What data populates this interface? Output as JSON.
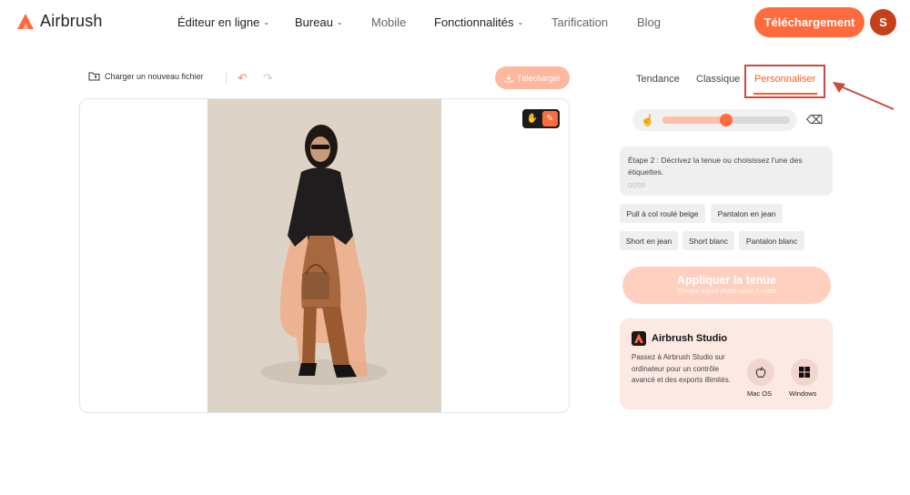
{
  "header": {
    "logo_text": "Airbrush",
    "nav": [
      {
        "label": "Éditeur en ligne",
        "has_dropdown": true
      },
      {
        "label": "Bureau",
        "has_dropdown": true
      },
      {
        "label": "Mobile",
        "has_dropdown": false
      },
      {
        "label": "Fonctionnalités",
        "has_dropdown": true
      },
      {
        "label": "Tarification",
        "has_dropdown": false
      },
      {
        "label": "Blog",
        "has_dropdown": false
      }
    ],
    "download_label": "Téléchargement",
    "avatar_initial": "S"
  },
  "toolbar": {
    "upload_label": "Charger un nouveau fichier",
    "download_label": "Télécharger"
  },
  "panel": {
    "tabs": [
      "Tendance",
      "Classique",
      "Personnaliser"
    ],
    "active_tab": "Personnaliser",
    "brush_size_fraction": 0.5,
    "prompt": {
      "text": "Étape 2 : Décrivez la tenue ou choisissez l'une des étiquettes.",
      "counter": "0/200"
    },
    "chips": [
      "Pull à col roulé beige",
      "Pantalon en jean",
      "Short en jean",
      "Short blanc",
      "Pantalon blanc"
    ],
    "apply": {
      "title": "Appliquer la tenue",
      "subtitle": "Chaque export photo coûte 1 crédit"
    },
    "studio": {
      "title": "Airbrush Studio",
      "description": "Passez à Airbrush Studio sur ordinateur pour un contrôle avancé et des exports illimités.",
      "mac_label": "Mac OS",
      "windows_label": "Windows"
    }
  },
  "colors": {
    "accent": "#ff6b3d",
    "annotation": "#c94a3f"
  }
}
